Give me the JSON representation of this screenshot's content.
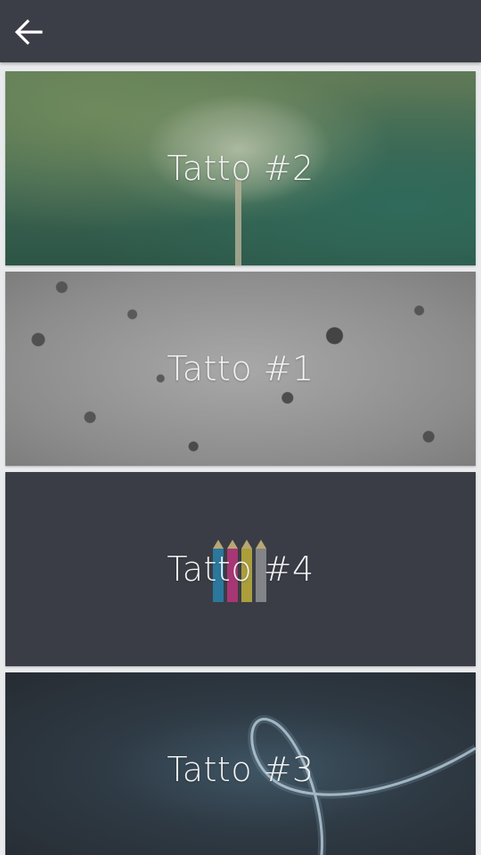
{
  "appbar": {
    "back_icon": "arrow-left-icon"
  },
  "cards": [
    {
      "title": "Tatto #2",
      "image": "dandelion"
    },
    {
      "title": "Tatto #1",
      "image": "stone-texture"
    },
    {
      "title": "Tatto #4",
      "image": "colored-pencils"
    },
    {
      "title": "Tatto #3",
      "image": "light-swirl"
    }
  ],
  "colors": {
    "appbar": "#3b3e47",
    "background": "#e9eaec",
    "title_text": "#f2f2f2"
  }
}
